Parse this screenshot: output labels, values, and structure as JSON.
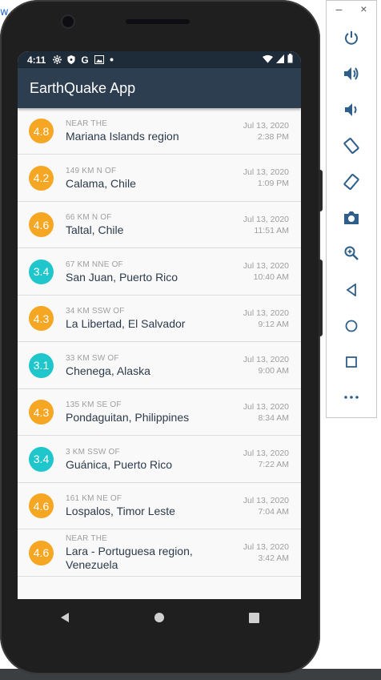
{
  "status_bar": {
    "time": "4:11"
  },
  "app_bar": {
    "title": "EarthQuake App"
  },
  "earthquakes": [
    {
      "mag": "4.8",
      "color": "#f5a623",
      "offset": "NEAR THE",
      "place": "Mariana Islands region",
      "date": "Jul 13, 2020",
      "time": "2:38 PM"
    },
    {
      "mag": "4.2",
      "color": "#f5a623",
      "offset": "149 KM N OF",
      "place": "Calama, Chile",
      "date": "Jul 13, 2020",
      "time": "1:09 PM"
    },
    {
      "mag": "4.6",
      "color": "#f5a623",
      "offset": "66 KM N OF",
      "place": "Taltal, Chile",
      "date": "Jul 13, 2020",
      "time": "11:51 AM"
    },
    {
      "mag": "3.4",
      "color": "#1fc6cc",
      "offset": "67 KM NNE OF",
      "place": "San Juan, Puerto Rico",
      "date": "Jul 13, 2020",
      "time": "10:40 AM"
    },
    {
      "mag": "4.3",
      "color": "#f5a623",
      "offset": "34 KM SSW OF",
      "place": "La Libertad, El Salvador",
      "date": "Jul 13, 2020",
      "time": "9:12 AM"
    },
    {
      "mag": "3.1",
      "color": "#1fc6cc",
      "offset": "33 KM SW OF",
      "place": "Chenega, Alaska",
      "date": "Jul 13, 2020",
      "time": "9:00 AM"
    },
    {
      "mag": "4.3",
      "color": "#f5a623",
      "offset": "135 KM SE OF",
      "place": "Pondaguitan, Philippines",
      "date": "Jul 13, 2020",
      "time": "8:34 AM"
    },
    {
      "mag": "3.4",
      "color": "#1fc6cc",
      "offset": "3 KM SSW OF",
      "place": "Guánica, Puerto Rico",
      "date": "Jul 13, 2020",
      "time": "7:22 AM"
    },
    {
      "mag": "4.6",
      "color": "#f5a623",
      "offset": "161 KM NE OF",
      "place": "Lospalos, Timor Leste",
      "date": "Jul 13, 2020",
      "time": "7:04 AM"
    },
    {
      "mag": "4.6",
      "color": "#f5a623",
      "offset": "NEAR THE",
      "place": "Lara - Portuguesa region, Venezuela",
      "date": "Jul 13, 2020",
      "time": "3:42 AM"
    }
  ],
  "emulator_toolbar": {
    "minimize": "–",
    "close": "×",
    "buttons": [
      "power-icon",
      "volume-up-icon",
      "volume-down-icon",
      "rotate-left-icon",
      "rotate-right-icon",
      "camera-icon",
      "zoom-icon",
      "back-icon",
      "home-icon",
      "overview-icon",
      "more-icon"
    ]
  },
  "colors": {
    "status_bar": "#1e2b38",
    "app_bar": "#2c3e50",
    "orange": "#f5a623",
    "teal": "#1fc6cc"
  }
}
